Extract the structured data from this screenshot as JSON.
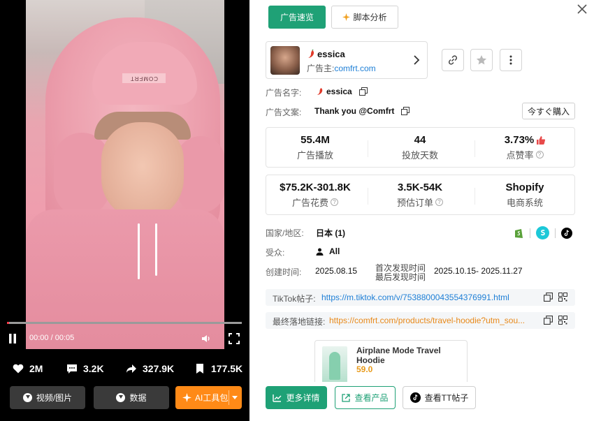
{
  "video": {
    "current_time": "00:00",
    "duration": "00:05",
    "progress_fraction": 0.01,
    "likes": "2M",
    "comments": "3.2K",
    "shares": "327.9K",
    "saves": "177.5K",
    "hood_print": "COMFRT"
  },
  "left_buttons": {
    "media": "视频/图片",
    "data": "数据",
    "ai": "AI工具包"
  },
  "tabs": {
    "overview": "广告速览",
    "script": "脚本分析"
  },
  "advertiser": {
    "name": "essica",
    "sub_label": "广告主:",
    "domain": "comfrt.com"
  },
  "fields": {
    "ad_name_label": "广告名字:",
    "ad_name": "essica",
    "ad_copy_label": "广告文案:",
    "ad_copy": "Thank you @Comfrt",
    "cta": "今すぐ購入",
    "country_label": "国家/地区:",
    "country": "日本 (1)",
    "audience_label": "受众:",
    "audience": "All",
    "created_label": "创建时间:",
    "created": "2025.08.15",
    "first_seen_label": "首次发现时间",
    "last_seen_label": "最后发现时间",
    "seen_range": "2025.10.15- 2025.11.27"
  },
  "metrics1": [
    {
      "value": "55.4M",
      "label": "广告播放"
    },
    {
      "value": "44",
      "label": "投放天数"
    },
    {
      "value": "3.73%",
      "label": "点赞率"
    }
  ],
  "metrics2": [
    {
      "value": "$75.2K-301.8K",
      "label": "广告花费"
    },
    {
      "value": "3.5K-54K",
      "label": "预估订单"
    },
    {
      "value": "Shopify",
      "label": "电商系统"
    }
  ],
  "links": {
    "tiktok_label": "TikTok帖子:",
    "tiktok_url": "https://m.tiktok.com/v/7538800043554376991.html",
    "landing_label": "最终落地链接:",
    "landing_url": "https://comfrt.com/products/travel-hoodie?utm_sou..."
  },
  "product": {
    "title": "Airplane Mode Travel Hoodie",
    "price": "59.0"
  },
  "bottom_buttons": {
    "details": "更多详情",
    "product": "查看产品",
    "tt_post": "查看TT帖子"
  },
  "colors": {
    "green": "#1fa176",
    "orange": "#ff8a17",
    "link_blue": "#1e7fd6",
    "landing_orange": "#e8891a",
    "progress_red": "#ff3b4a"
  }
}
